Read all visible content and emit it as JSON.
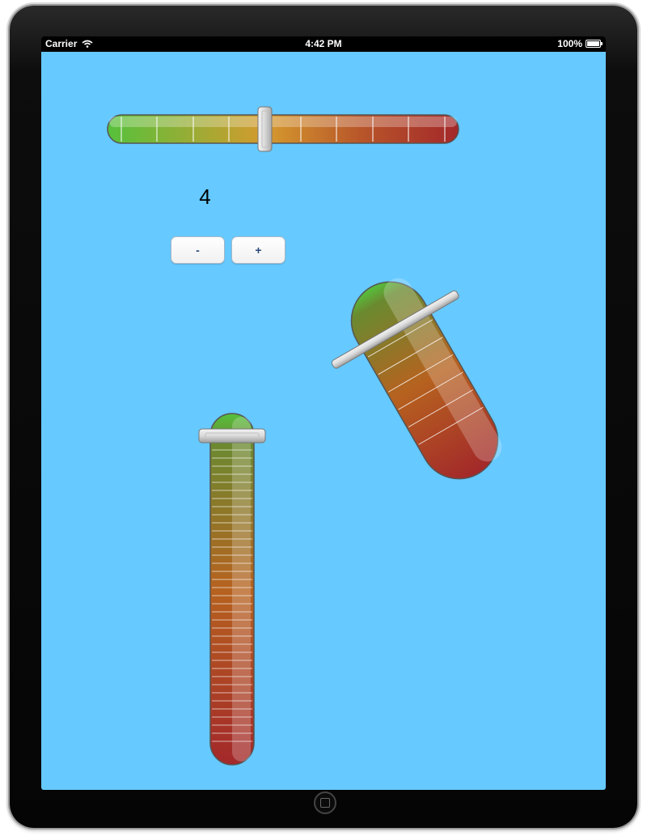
{
  "status_bar": {
    "carrier": "Carrier",
    "time": "4:42 PM",
    "battery": "100%"
  },
  "value_label": "4",
  "buttons": {
    "minus": "-",
    "plus": "+"
  },
  "sliders": [
    {
      "name": "horizontal",
      "ticks": 10,
      "value_fraction": 0.45
    },
    {
      "name": "rotated",
      "ticks": 10,
      "value_fraction": 0.0
    },
    {
      "name": "vertical",
      "ticks": 40,
      "value_fraction": 0.0
    }
  ],
  "colors": {
    "background": "#66c9ff",
    "track_start": "#55c13c",
    "track_mid": "#d59a2e",
    "track_end": "#a3282a",
    "thumb": "#e0e0e0"
  }
}
